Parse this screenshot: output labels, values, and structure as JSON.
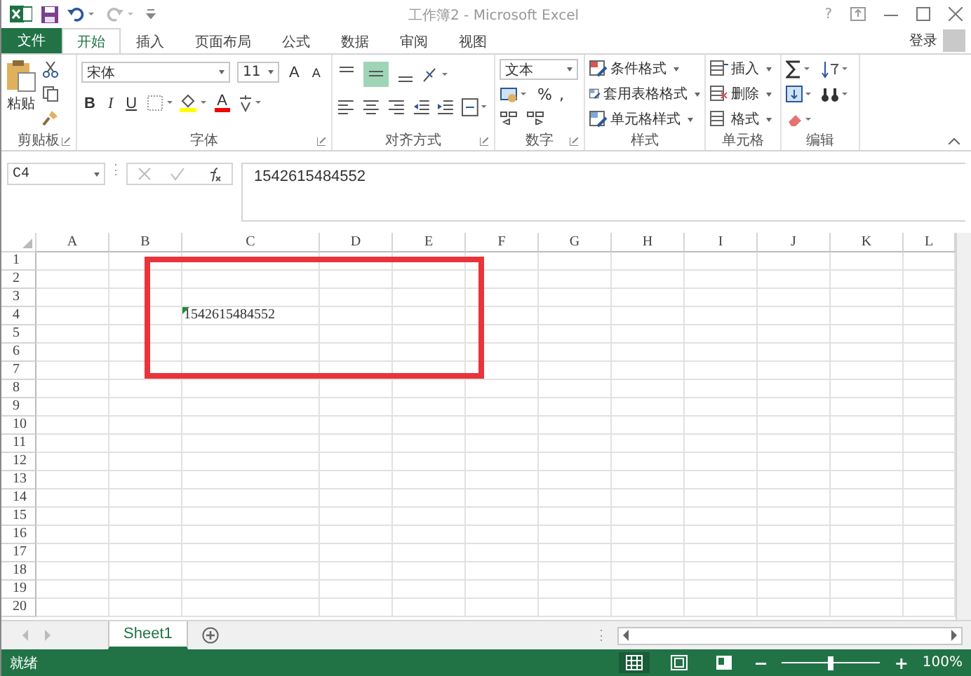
{
  "title_bar": {
    "title": "工作簿2 - Microsoft Excel",
    "help": "?"
  },
  "tabs": [
    {
      "label": "文件",
      "kind": "file",
      "selected": false
    },
    {
      "label": "开始",
      "kind": "tab",
      "selected": true
    },
    {
      "label": "插入",
      "kind": "tab",
      "selected": false
    },
    {
      "label": "页面布局",
      "kind": "tab",
      "selected": false
    },
    {
      "label": "公式",
      "kind": "tab",
      "selected": false
    },
    {
      "label": "数据",
      "kind": "tab",
      "selected": false
    },
    {
      "label": "审阅",
      "kind": "tab",
      "selected": false
    },
    {
      "label": "视图",
      "kind": "tab",
      "selected": false
    }
  ],
  "account": {
    "label": "登录"
  },
  "ribbon": {
    "clipboard": {
      "paste": "粘贴",
      "label": "剪贴板"
    },
    "font": {
      "font_name": "宋体",
      "font_size": "11",
      "grow": "A",
      "shrink": "A",
      "bold": "B",
      "italic": "I",
      "underline": "U",
      "font_color": "A",
      "label": "字体"
    },
    "alignment": {
      "label": "对齐方式",
      "middle_align_selected": true
    },
    "number": {
      "format": "文本",
      "percent": "%",
      "comma": ",",
      "label": "数字"
    },
    "styles": {
      "items": [
        "条件格式",
        "套用表格格式",
        "单元格样式"
      ],
      "label": "样式"
    },
    "cells": {
      "items": [
        "插入",
        "删除",
        "格式"
      ],
      "label": "单元格"
    },
    "editing": {
      "label": "编辑"
    }
  },
  "formula_bar": {
    "name_box": "C4",
    "formula": "1542615484552"
  },
  "sheet": {
    "columns": [
      "A",
      "B",
      "C",
      "D",
      "E",
      "F",
      "G",
      "H",
      "I",
      "J",
      "K",
      "L"
    ],
    "rows": [
      {
        "header": "1"
      },
      {
        "header": "2"
      },
      {
        "header": "3"
      },
      {
        "header": "4",
        "cells": [
          {
            "kind": "blank"
          },
          {
            "kind": "blank"
          },
          {
            "kind": "text",
            "value": "1542615484552",
            "error_flag": true
          }
        ]
      },
      {
        "header": "5"
      },
      {
        "header": "6"
      },
      {
        "header": "7"
      },
      {
        "header": "8"
      },
      {
        "header": "9"
      },
      {
        "header": "10"
      },
      {
        "header": "11"
      },
      {
        "header": "12"
      },
      {
        "header": "13"
      },
      {
        "header": "14"
      },
      {
        "header": "15"
      },
      {
        "header": "16"
      },
      {
        "header": "17"
      },
      {
        "header": "18"
      },
      {
        "header": "19"
      },
      {
        "header": "20"
      }
    ]
  },
  "sheet_tabs": [
    {
      "label": "Sheet1",
      "selected": true
    }
  ],
  "status_bar": {
    "status": "就绪",
    "views": [
      {
        "kind": "normal",
        "selected": true
      },
      {
        "kind": "page_layout",
        "selected": false
      },
      {
        "kind": "page_break",
        "selected": false
      }
    ],
    "zoom": {
      "minus": "−",
      "level": 0.5,
      "plus": "+",
      "reading": "100%"
    }
  }
}
